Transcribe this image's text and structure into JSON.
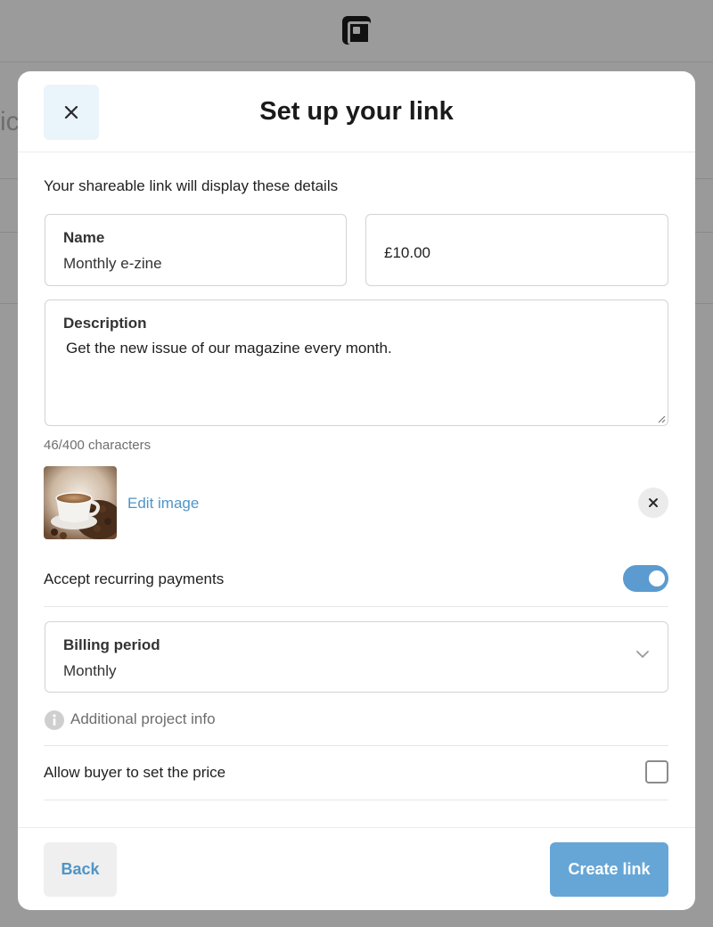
{
  "modal": {
    "title": "Set up your link",
    "intro": "Your shareable link will display these details"
  },
  "fields": {
    "name": {
      "label": "Name",
      "value": "Monthly e-zine"
    },
    "price": {
      "value": "£10.00"
    },
    "description": {
      "label": "Description",
      "value": "Get the new issue of our magazine every month."
    },
    "char_count": "46/400 characters"
  },
  "image": {
    "edit_label": "Edit image"
  },
  "recurring": {
    "label": "Accept recurring payments",
    "enabled": true
  },
  "billing": {
    "label": "Billing period",
    "value": "Monthly"
  },
  "info": {
    "text": "Additional project info"
  },
  "buyer_price": {
    "label": "Allow buyer to set the price",
    "checked": false
  },
  "footer": {
    "back_label": "Back",
    "create_label": "Create link"
  },
  "colors": {
    "accent": "#4f95c7",
    "primary_button": "#66a6d6",
    "toggle_on": "#5b9bd0",
    "close_button_bg": "#eaf4fb"
  },
  "icons": {
    "close": "close-icon",
    "remove_image": "close-icon",
    "chevron": "chevron-down-icon",
    "info": "info-icon",
    "logo": "square-logo-icon"
  }
}
